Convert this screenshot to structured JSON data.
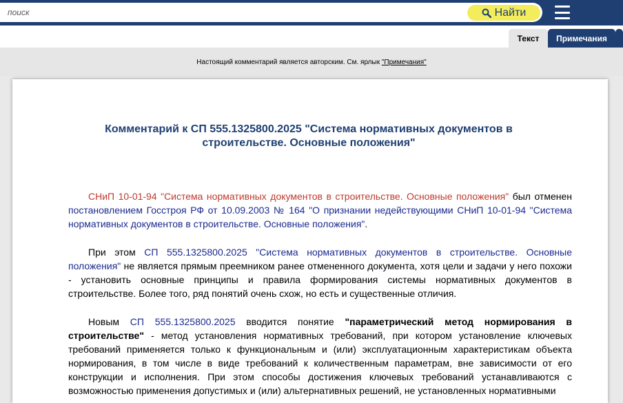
{
  "search": {
    "placeholder": "поиск",
    "button_label": "Найти"
  },
  "tabs": {
    "text": "Текст",
    "notes": "Примечания"
  },
  "notice": {
    "text": "Настоящий комментарий является авторским. См. ярлык ",
    "link": "\"Примечания\""
  },
  "document": {
    "title": "Комментарий к СП 555.1325800.2025 \"Система нормативных документов в строительстве. Основные положения\"",
    "p1": {
      "link1": "СНиП 10-01-94 \"Система нормативных документов в строительстве. Основные положения\"",
      "t1": " был отменен ",
      "link2": "постановлением Госстроя РФ от 10.09.2003 № 164 \"О признании недействующими СНиП 10-01-94 \"Система нормативных документов в строительстве. Основные положения\"",
      "t2": "."
    },
    "p2": {
      "t0": "При этом ",
      "link1": "СП 555.1325800.2025 \"Система нормативных документов в строительстве. Основные положения\"",
      "t1": " не является прямым преемником ранее отмененного документа, хотя цели и задачи у него похожи - установить основные принципы и правила формирования системы нормативных документов в строительстве. Более того, ряд понятий очень схож, но есть и существенные отличия."
    },
    "p3": {
      "t0": "Новым ",
      "link1": "СП 555.1325800.2025",
      "t1": " вводится понятие ",
      "term": "\"параметрический метод нормирования в строительстве\"",
      "t2": " - метод установления нормативных требований, при котором установление ключевых требований применяется только к функциональным и (или) эксплуатационным характеристикам объекта нормирования, в том числе в виде требований к количественным параметрам, вне зависимости от его конструкции и исполнения. При этом способы достижения ключевых требований устанавливаются с возможностью применения допустимых и (или) альтернативных решений, не установленных нормативными"
    }
  }
}
